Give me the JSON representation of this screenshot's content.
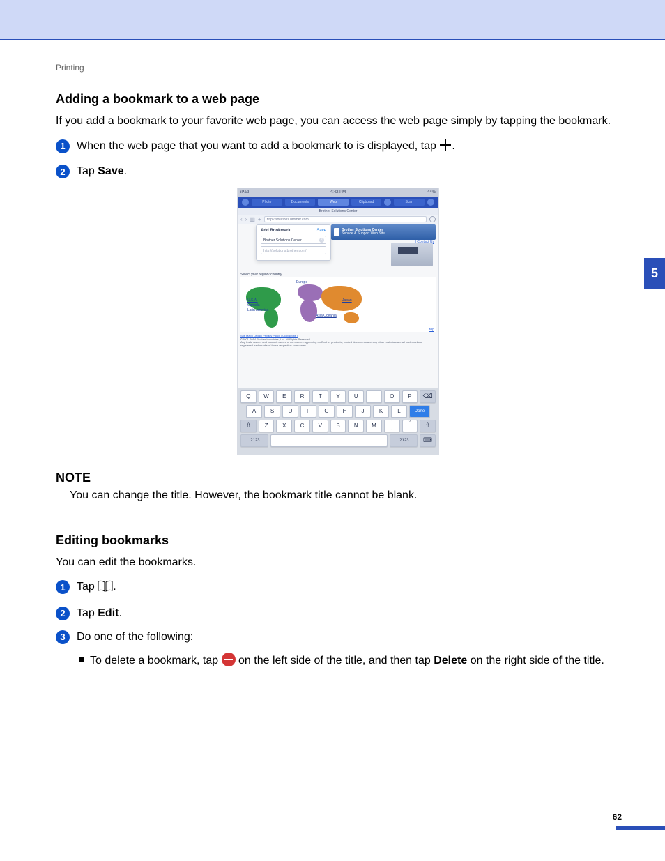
{
  "breadcrumb": "Printing",
  "side_tab": "5",
  "page_number": "62",
  "section1": {
    "heading": "Adding a bookmark to a web page",
    "intro": "If you add a bookmark to your favorite web page, you can access the web page simply by tapping the bookmark.",
    "step1_pre": "When the web page that you want to add a bookmark to is displayed, tap ",
    "step1_post": ".",
    "step2_pre": "Tap ",
    "step2_bold": "Save",
    "step2_post": "."
  },
  "note": {
    "label": "NOTE",
    "body": "You can change the title. However, the bookmark title cannot be blank."
  },
  "section2": {
    "heading": "Editing bookmarks",
    "intro": "You can edit the bookmarks.",
    "step1_pre": "Tap ",
    "step1_post": ".",
    "step2_pre": "Tap ",
    "step2_bold": "Edit",
    "step2_post": ".",
    "step3": "Do one of the following:",
    "bullet_pre": "To delete a bookmark, tap ",
    "bullet_mid": " on the left side of the title, and then tap ",
    "bullet_bold": "Delete",
    "bullet_post": " on the right side of the title."
  },
  "fig": {
    "status_left": "iPad",
    "status_center": "4:42 PM",
    "status_right": "44%",
    "tabs": {
      "photo": "Photo",
      "documents": "Documents",
      "web": "Web",
      "clipboard": "Clipboard",
      "scan": "Scan"
    },
    "subtitle": "Brother Solutions Center",
    "url": "http://solutions.brother.com/",
    "popup": {
      "title": "Add Bookmark",
      "save": "Save",
      "field_title": "Brother Solutions Center",
      "field_url": "http://solutions.brother.com/"
    },
    "bsc": {
      "name": "Brother Solutions Center",
      "sub": "Service & Support Web Site"
    },
    "contact": "| Contact Us",
    "region_label": "Select your region/ country",
    "map_labels": {
      "usa": "U.S.A.",
      "canada": "Canada",
      "latam": "Latin America",
      "europe": "Europe",
      "japan": "Japan",
      "asia": "Asia Oceania"
    },
    "top_link": "top",
    "footer_links": "Site Map | Legal | Privacy Policy | Global Site |",
    "footer_copy": "©2001-2014 Brother Industries, Ltd. All Rights Reserved.",
    "footer_tm": "Any trade names and product names of companies appearing on Brother products, related documents and any other materials are all trademarks or registered trademarks of those respective companies.",
    "kbd": {
      "r1": [
        "Q",
        "W",
        "E",
        "R",
        "T",
        "Y",
        "U",
        "I",
        "O",
        "P"
      ],
      "r2": [
        "A",
        "S",
        "D",
        "F",
        "G",
        "H",
        "J",
        "K",
        "L"
      ],
      "r3": [
        "Z",
        "X",
        "C",
        "V",
        "B",
        "N",
        "M"
      ],
      "punc1": "!",
      "punc1b": ",",
      "punc2": "?",
      "punc2b": ".",
      "done": "Done",
      "n123": ".?123"
    }
  }
}
